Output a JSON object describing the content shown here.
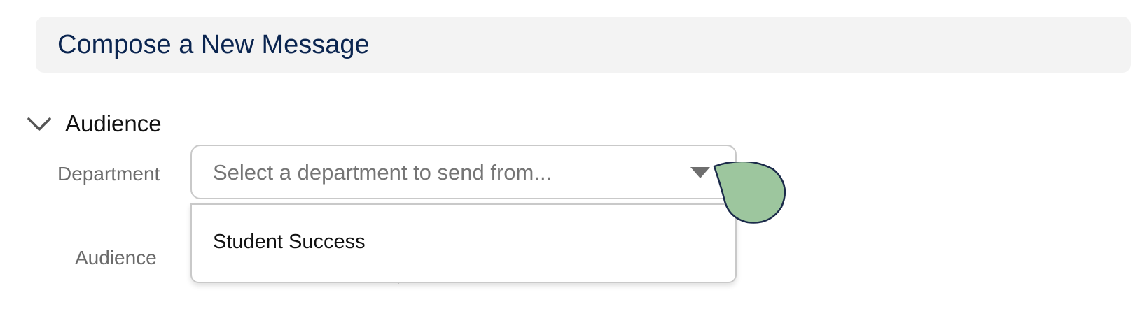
{
  "header": {
    "title": "Compose a New Message"
  },
  "section": {
    "title": "Audience",
    "toggle_icon": "chevron-down-icon"
  },
  "fields": {
    "department": {
      "label": "Department",
      "placeholder": "Select a department to send from...",
      "caret_icon": "caret-down-icon",
      "options": [
        "Student Success"
      ]
    },
    "audience": {
      "label": "Audience"
    }
  },
  "colors": {
    "title": "#0b2550",
    "header_bg": "#f3f3f3",
    "cursor_fill": "#9dc69e",
    "cursor_stroke": "#1b2a4a"
  }
}
